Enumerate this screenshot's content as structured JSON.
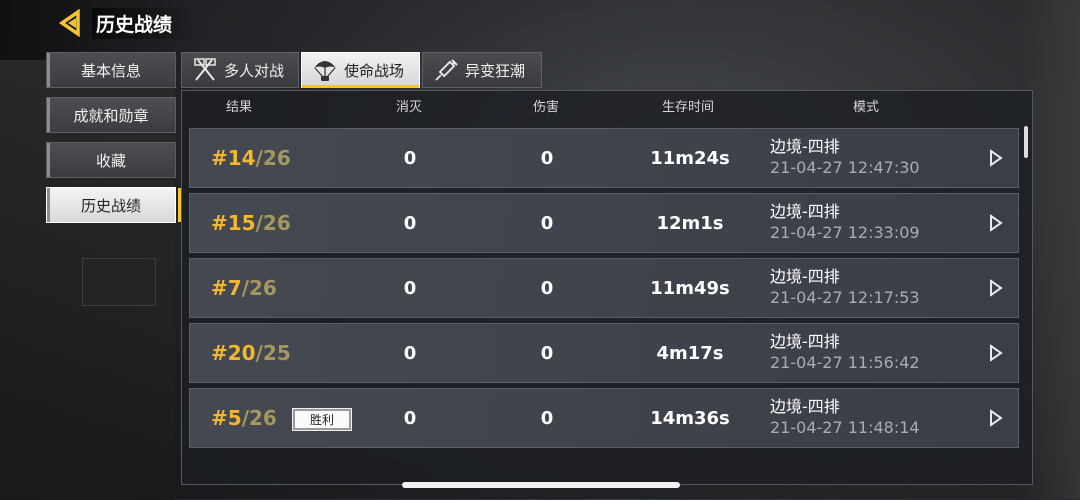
{
  "header": {
    "title": "历史战绩"
  },
  "sidebar": {
    "items": [
      {
        "label": "基本信息",
        "active": false
      },
      {
        "label": "成就和勋章",
        "active": false
      },
      {
        "label": "收藏",
        "active": false
      },
      {
        "label": "历史战绩",
        "active": true
      }
    ]
  },
  "tabs": [
    {
      "label": "多人对战",
      "icon": "crossed-flags-icon",
      "active": false
    },
    {
      "label": "使命战场",
      "icon": "parachute-icon",
      "active": true
    },
    {
      "label": "异变狂潮",
      "icon": "syringe-icon",
      "active": false
    }
  ],
  "table": {
    "columns": {
      "result": "结果",
      "kills": "消灭",
      "damage": "伤害",
      "survival": "生存时间",
      "mode": "模式"
    },
    "rows": [
      {
        "rank": "#14",
        "total": "/26",
        "badge": "",
        "kills": "0",
        "damage": "0",
        "survival": "11m24s",
        "mode": "边境-四排",
        "time": "21-04-27 12:47:30"
      },
      {
        "rank": "#15",
        "total": "/26",
        "badge": "",
        "kills": "0",
        "damage": "0",
        "survival": "12m1s",
        "mode": "边境-四排",
        "time": "21-04-27 12:33:09"
      },
      {
        "rank": "#7",
        "total": "/26",
        "badge": "",
        "kills": "0",
        "damage": "0",
        "survival": "11m49s",
        "mode": "边境-四排",
        "time": "21-04-27 12:17:53"
      },
      {
        "rank": "#20",
        "total": "/25",
        "badge": "",
        "kills": "0",
        "damage": "0",
        "survival": "4m17s",
        "mode": "边境-四排",
        "time": "21-04-27 11:56:42"
      },
      {
        "rank": "#5",
        "total": "/26",
        "badge": "胜利",
        "kills": "0",
        "damage": "0",
        "survival": "14m36s",
        "mode": "边境-四排",
        "time": "21-04-27 11:48:14"
      }
    ]
  },
  "colors": {
    "accent": "#f4c430",
    "rank": "#f3b62f",
    "total": "#a69761",
    "timestamp": "#a9adb3"
  }
}
